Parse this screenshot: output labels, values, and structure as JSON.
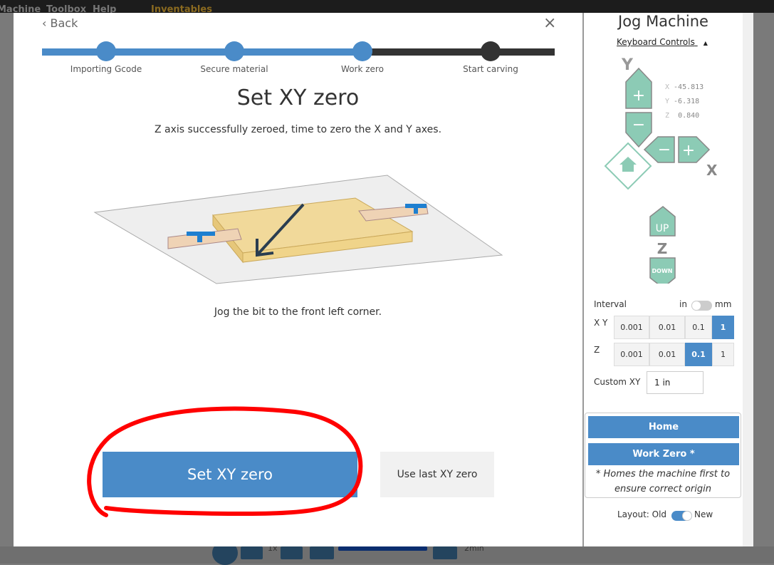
{
  "topbar": {
    "menu": [
      "Machine",
      "Toolbox",
      "Help"
    ],
    "brand": "Inventables"
  },
  "bottombar": {
    "speed": "1x",
    "time": "2min"
  },
  "wizard": {
    "back_label": "Back",
    "close_icon": "close-icon",
    "steps": [
      {
        "label": "Importing Gcode",
        "state": "done"
      },
      {
        "label": "Secure material",
        "state": "done"
      },
      {
        "label": "Work zero",
        "state": "current"
      },
      {
        "label": "Start carving",
        "state": "pending"
      }
    ],
    "title": "Set XY zero",
    "subtitle": "Z axis successfully zeroed, time to zero the X and Y axes.",
    "hint": "Jog the bit to the front left corner.",
    "primary_label": "Set XY zero",
    "secondary_label": "Use last XY zero",
    "colors": {
      "accent": "#4a8bc8",
      "pending": "#333333",
      "annotation": "#ff0000"
    }
  },
  "jog": {
    "title": "Jog Machine",
    "keyboard_controls": "Keyboard Controls",
    "axis_y": "Y",
    "axis_x": "X",
    "axis_z": "Z",
    "plus": "+",
    "minus": "−",
    "up": "UP",
    "down": "DOWN",
    "coords": [
      {
        "axis": "X",
        "value": "-45.813"
      },
      {
        "axis": "Y",
        "value": "-6.318"
      },
      {
        "axis": "Z",
        "value": "0.840"
      }
    ],
    "interval_label": "Interval",
    "unit_in": "in",
    "unit_mm": "mm",
    "xy_label": "X Y",
    "z_label": "Z",
    "xy_options": [
      "0.001",
      "0.01",
      "0.1",
      "1"
    ],
    "xy_selected": "1",
    "z_options": [
      "0.001",
      "0.01",
      "0.1",
      "1"
    ],
    "z_selected": "0.1",
    "custom_label": "Custom XY",
    "custom_value": "1 in",
    "home_label": "Home",
    "work_zero_label": "Work Zero *",
    "note": "* Homes the machine first to ensure correct origin",
    "layout_label": "Layout: Old",
    "layout_new": "New",
    "colors": {
      "jog": "#8ccbb5"
    }
  }
}
